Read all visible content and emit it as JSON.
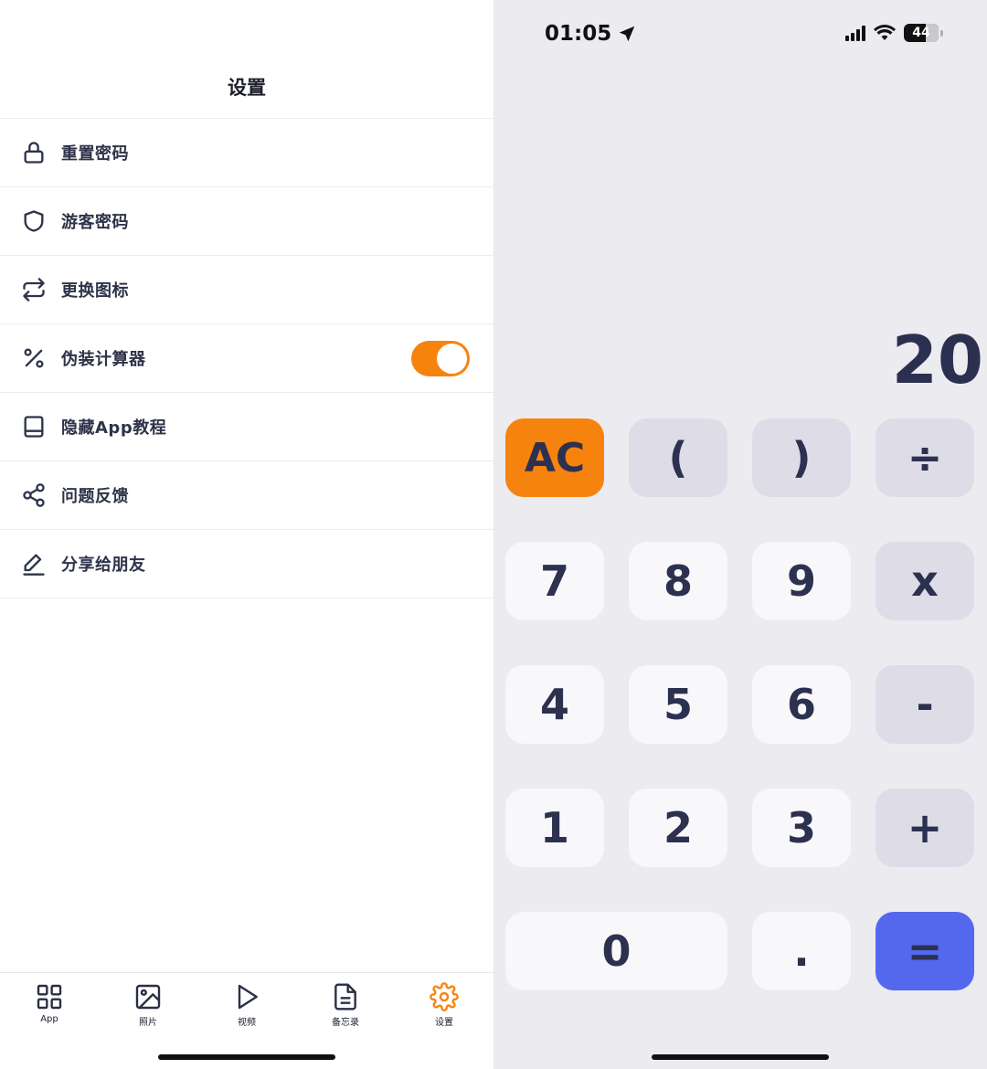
{
  "settings": {
    "title": "设置",
    "items": [
      {
        "label": "重置密码",
        "icon": "lock-icon"
      },
      {
        "label": "游客密码",
        "icon": "shield-icon"
      },
      {
        "label": "更换图标",
        "icon": "repeat-icon"
      },
      {
        "label": "伪装计算器",
        "icon": "percent-icon",
        "toggle": true
      },
      {
        "label": "隐藏App教程",
        "icon": "book-icon"
      },
      {
        "label": "问题反馈",
        "icon": "share-nodes-icon"
      },
      {
        "label": "分享给朋友",
        "icon": "edit-icon"
      }
    ]
  },
  "tabbar": {
    "tabs": [
      {
        "label": "App",
        "icon": "grid-icon"
      },
      {
        "label": "照片",
        "icon": "image-icon"
      },
      {
        "label": "视频",
        "icon": "play-icon"
      },
      {
        "label": "备忘录",
        "icon": "document-icon"
      },
      {
        "label": "设置",
        "icon": "gear-icon",
        "active": true
      }
    ]
  },
  "status": {
    "time": "01:05",
    "battery": "44"
  },
  "calculator": {
    "display": "20",
    "keys": {
      "ac": "AC",
      "paren_open": "(",
      "paren_close": ")",
      "divide": "÷",
      "k7": "7",
      "k8": "8",
      "k9": "9",
      "multiply": "x",
      "k4": "4",
      "k5": "5",
      "k6": "6",
      "minus": "-",
      "k1": "1",
      "k2": "2",
      "k3": "3",
      "plus": "+",
      "k0": "0",
      "dot": ".",
      "equals": "="
    }
  },
  "colors": {
    "accent": "#f7830f",
    "equals": "#5468ee",
    "operator_key": "#dedde7",
    "number_key": "#f8f8fa",
    "calc_bg": "#ebebf0"
  }
}
